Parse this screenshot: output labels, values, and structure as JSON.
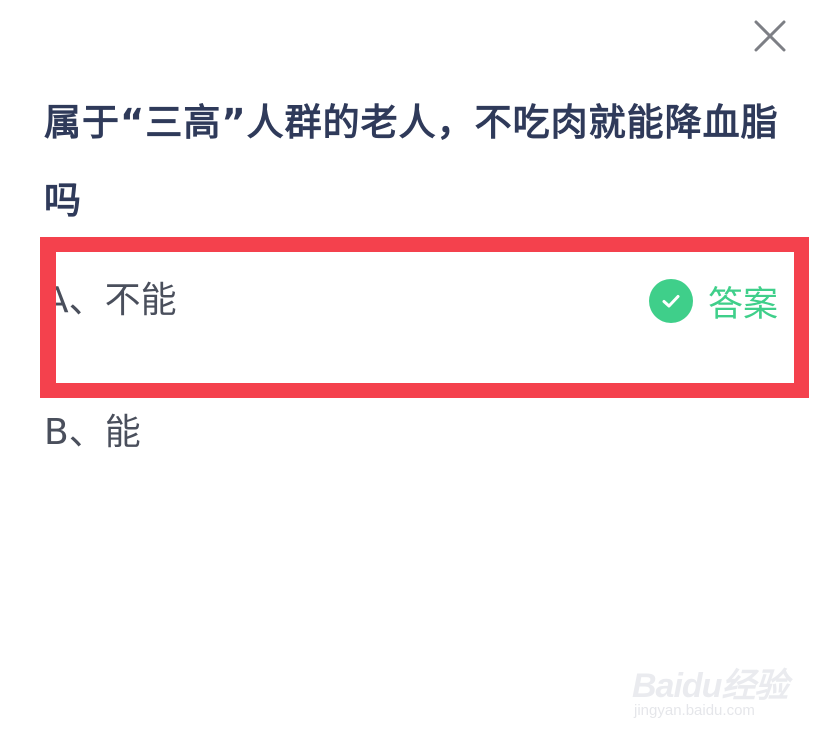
{
  "question": {
    "text": "属于“三高”人群的老人，不吃肉就能降血脂吗"
  },
  "options": [
    {
      "label": "A、不能",
      "is_answer": true,
      "answer_label": "答案"
    },
    {
      "label": "B、能",
      "is_answer": false
    }
  ],
  "icons": {
    "close": "close-icon",
    "check": "check-circle-icon"
  },
  "colors": {
    "question_text": "#2f3a5a",
    "option_text": "#4a4f5c",
    "answer_green": "#3fcf8a",
    "highlight_red": "#f4414d"
  },
  "watermark": {
    "logo_text": "Baidu经验",
    "url": "jingyan.baidu.com"
  }
}
